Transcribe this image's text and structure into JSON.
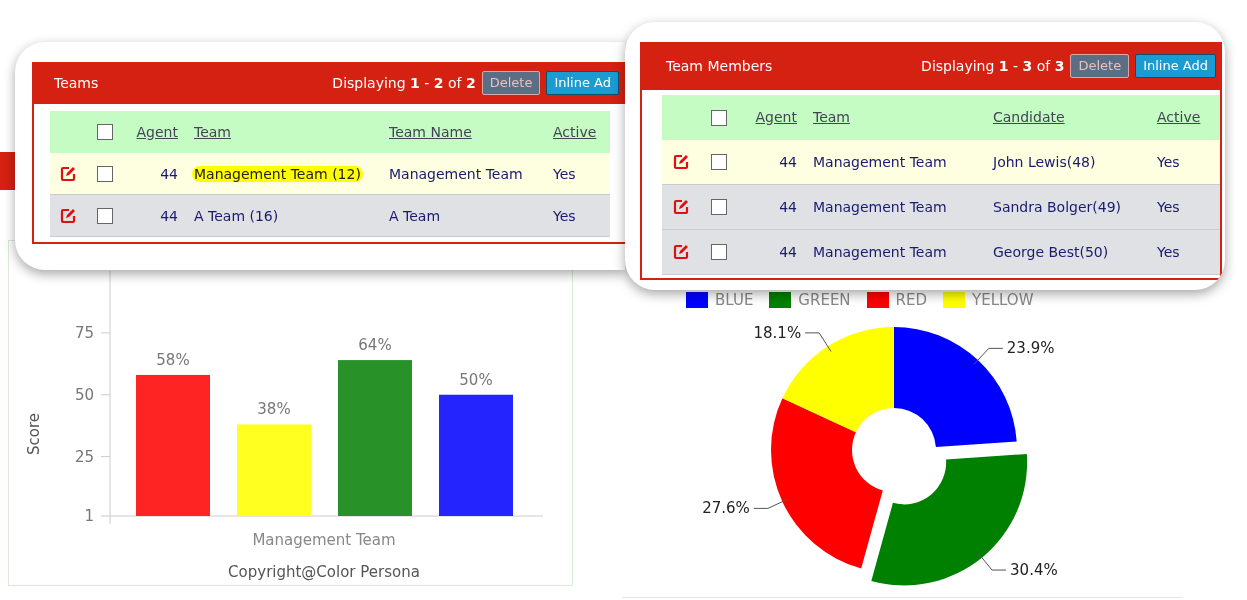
{
  "teams_panel": {
    "title": "Teams",
    "paging": "Displaying **1** - **2** of **2**",
    "buttons": [
      {
        "label": "Delete",
        "kind": "delete"
      },
      {
        "label": "Inline Ad",
        "kind": "add"
      }
    ],
    "columns": [
      "Agent",
      "Team",
      "Team Name",
      "Active"
    ],
    "header_checked": false,
    "rows": [
      {
        "checked": false,
        "highlighted": true,
        "cells": [
          "44",
          "Management Team (12)",
          "Management Team",
          "Yes"
        ]
      },
      {
        "checked": false,
        "highlighted": false,
        "cells": [
          "44",
          "A Team (16)",
          "A Team",
          "Yes"
        ]
      }
    ]
  },
  "members_panel": {
    "title": "Team Members",
    "paging": "Displaying **1** - **3** of **3**",
    "buttons": [
      {
        "label": "Delete",
        "kind": "delete"
      },
      {
        "label": "Inline Add",
        "kind": "add"
      }
    ],
    "columns": [
      "Agent",
      "Team",
      "Candidate",
      "Active"
    ],
    "header_checked": false,
    "rows": [
      {
        "checked": false,
        "highlighted": false,
        "cells": [
          "44",
          "Management Team",
          "John Lewis(48)",
          "Yes"
        ]
      },
      {
        "checked": false,
        "highlighted": false,
        "cells": [
          "44",
          "Management Team",
          "Sandra Bolger(49)",
          "Yes"
        ]
      },
      {
        "checked": false,
        "highlighted": false,
        "cells": [
          "44",
          "Management Team",
          "George Best(50)",
          "Yes"
        ]
      }
    ]
  },
  "score_chart": {
    "chart_data": {
      "type": "bar",
      "xlabel": "Copyright@Color Persona",
      "ylabel": "Score",
      "categories": [
        "Management Team"
      ],
      "ylim": [
        1,
        100
      ],
      "yticks": [
        1,
        25,
        50,
        75
      ],
      "series": [
        {
          "color": "#ff2424",
          "values": [
            58
          ]
        },
        {
          "color": "#ffff20",
          "values": [
            38
          ]
        },
        {
          "color": "#289228",
          "values": [
            64
          ]
        },
        {
          "color": "#2424ff",
          "values": [
            50
          ]
        }
      ],
      "value_labels": [
        "58%",
        "38%",
        "64%",
        "50%"
      ]
    }
  },
  "color_chart": {
    "slices": [
      {
        "color": "#0000ff",
        "exploded": false
      },
      {
        "color": "#008000",
        "exploded": true
      },
      {
        "color": "#ff0000",
        "exploded": false
      },
      {
        "color": "#ffff00",
        "exploded": false
      }
    ],
    "chart_data": {
      "type": "donut",
      "categories": [
        "BLUE",
        "GREEN",
        "RED",
        "YELLOW"
      ],
      "values": [
        23.9,
        30.4,
        27.6,
        18.1
      ],
      "value_labels": [
        "23.9%",
        "30.4%",
        "27.6%",
        "18.1%"
      ]
    }
  }
}
